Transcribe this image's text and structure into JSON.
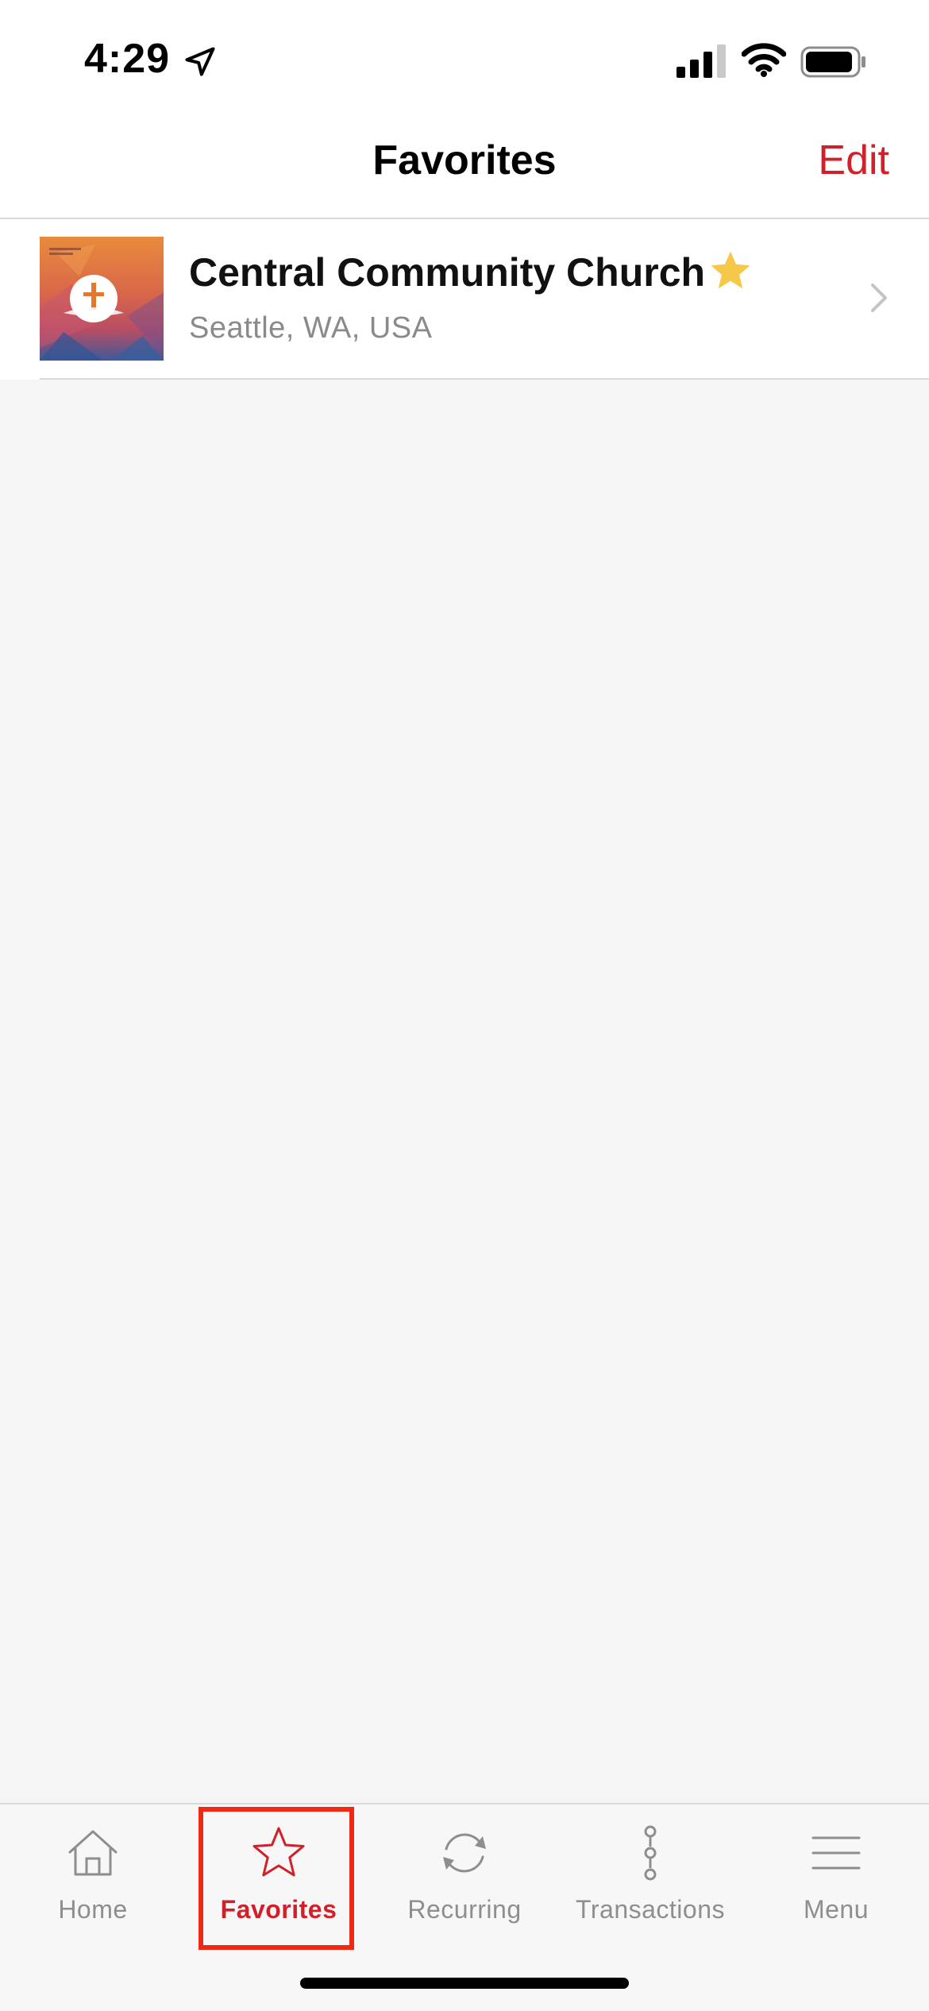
{
  "status_bar": {
    "time": "4:29",
    "icons": [
      "location-arrow-icon",
      "cellular-signal-icon",
      "wifi-icon",
      "battery-icon"
    ]
  },
  "nav": {
    "title": "Favorites",
    "edit_label": "Edit"
  },
  "favorites": [
    {
      "name": "Central Community Church",
      "location": "Seattle, WA, USA",
      "favorited": true,
      "thumbnail_icon": "church-logo-image"
    }
  ],
  "tab_bar": {
    "tabs": [
      {
        "label": "Home",
        "icon": "home-icon",
        "active": false
      },
      {
        "label": "Favorites",
        "icon": "star-outline-icon",
        "active": true
      },
      {
        "label": "Recurring",
        "icon": "recurring-icon",
        "active": false
      },
      {
        "label": "Transactions",
        "icon": "transactions-icon",
        "active": false
      },
      {
        "label": "Menu",
        "icon": "menu-icon",
        "active": false
      }
    ]
  },
  "colors": {
    "accent": "#d0202a",
    "star": "#f5c84a",
    "highlight": "#ee2a14",
    "background": "#f5f5f5"
  }
}
